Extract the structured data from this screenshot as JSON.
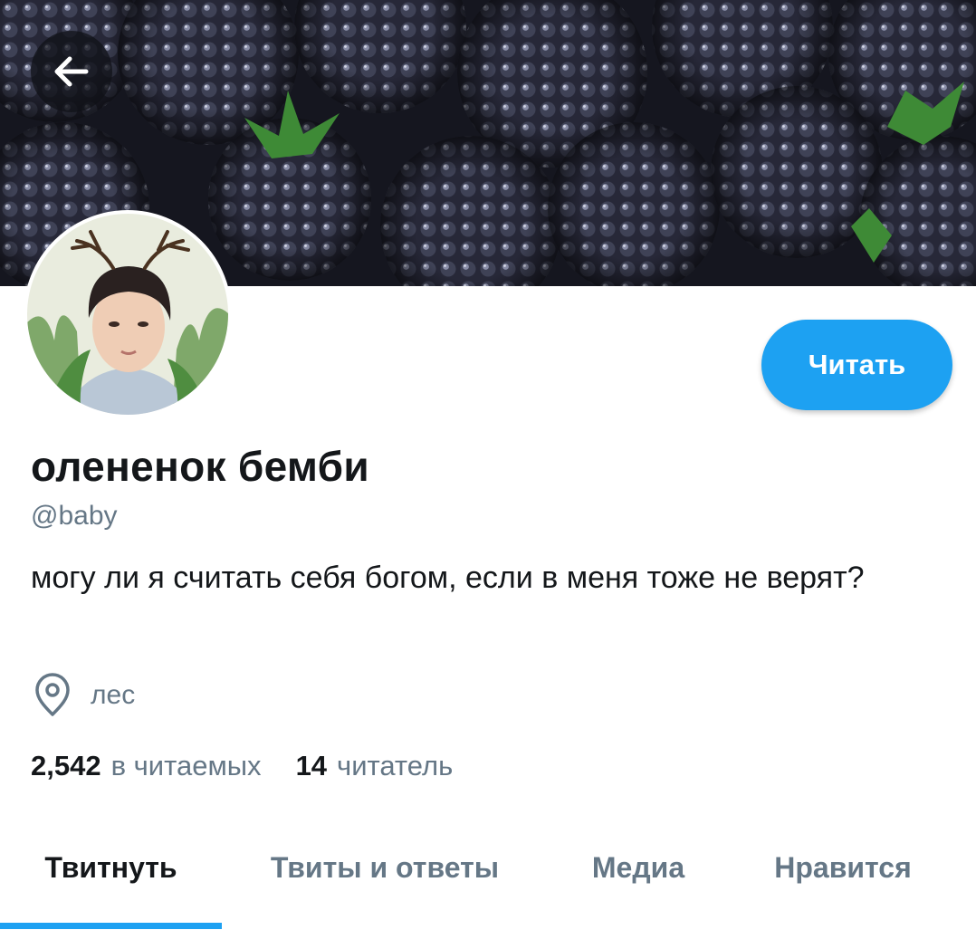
{
  "header": {
    "banner_image": "blackberries-banner",
    "back_icon": "arrow-left-icon"
  },
  "profile": {
    "avatar_image": "avatar-photo-with-antlers",
    "display_name": "олененок бемби",
    "handle": "@baby",
    "bio": "могу ли я считать себя  богом, если  в меня тоже не верят?",
    "location": "лес",
    "location_icon": "location-pin-icon",
    "follow_label": "Читать"
  },
  "stats": {
    "following_count": "2,542",
    "following_label": "в читаемых",
    "followers_count": "14",
    "followers_label": "читатель"
  },
  "tabs": [
    {
      "label": "Твитнуть",
      "active": true
    },
    {
      "label": "Твиты и ответы",
      "active": false
    },
    {
      "label": "Медиа",
      "active": false
    },
    {
      "label": "Нравится",
      "active": false
    }
  ],
  "colors": {
    "accent": "#1da1f2",
    "text_primary": "#14171a",
    "text_secondary": "#657786"
  }
}
